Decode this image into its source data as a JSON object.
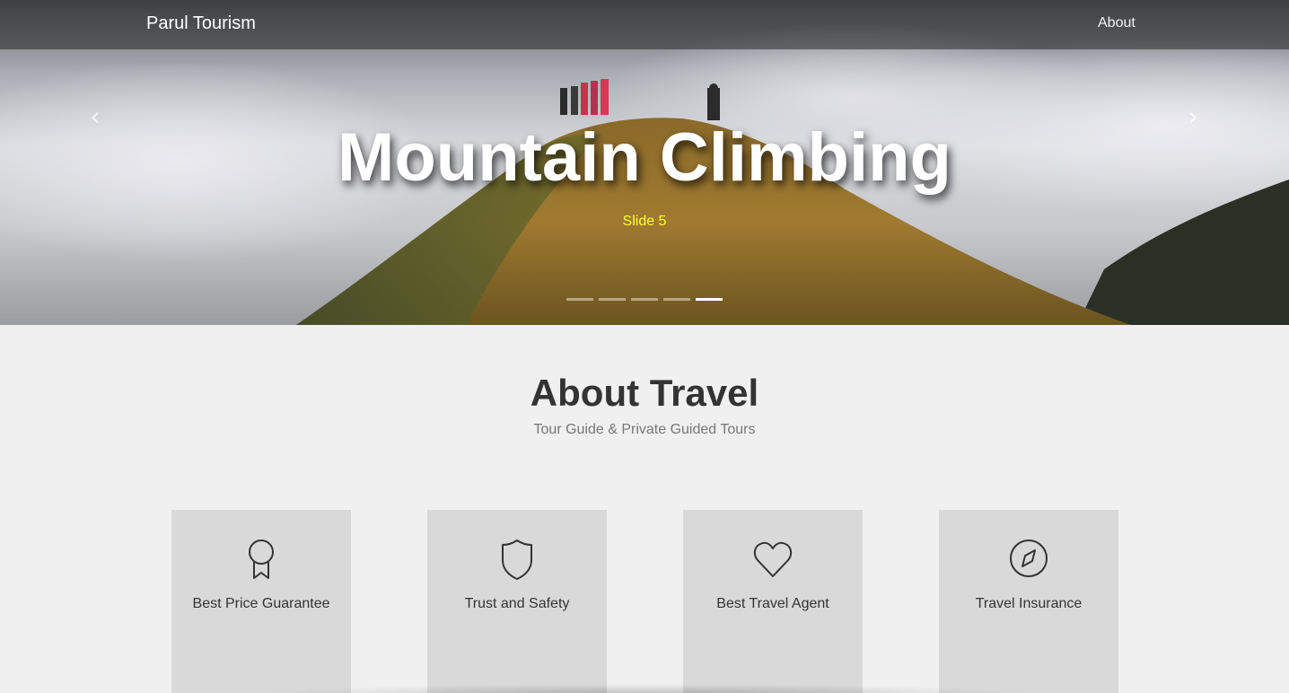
{
  "navbar": {
    "brand": "Parul Tourism",
    "links": [
      "About"
    ]
  },
  "carousel": {
    "title": "Mountain Climbing",
    "caption": "Slide 5",
    "prev_icon": "chevron-left-icon",
    "next_icon": "chevron-right-icon",
    "slide_count": 5,
    "active_slide": 5,
    "caption_color": "#ffff33"
  },
  "about": {
    "title": "About Travel",
    "subtitle": "Tour Guide & Private Guided Tours",
    "features": [
      {
        "label": "Best Price Guarantee",
        "icon": "award-ribbon-icon"
      },
      {
        "label": "Trust and Safety",
        "icon": "shield-icon"
      },
      {
        "label": "Best Travel Agent",
        "icon": "heart-icon"
      },
      {
        "label": "Travel Insurance",
        "icon": "compass-icon"
      }
    ]
  }
}
